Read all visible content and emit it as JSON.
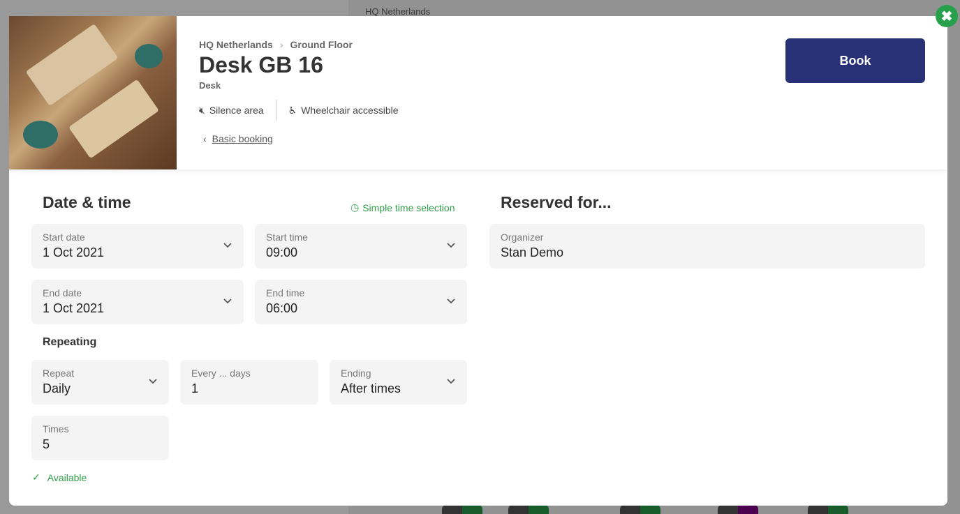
{
  "background": {
    "location": "HQ Netherlands"
  },
  "header": {
    "breadcrumb": [
      "HQ Netherlands",
      "Ground Floor"
    ],
    "title": "Desk GB 16",
    "type": "Desk",
    "features": [
      {
        "icon": "volume-off-icon",
        "label": "Silence area"
      },
      {
        "icon": "wheelchair-icon",
        "label": "Wheelchair accessible"
      }
    ],
    "basic_booking": "Basic booking",
    "book_label": "Book"
  },
  "datetime": {
    "heading": "Date & time",
    "simple_time": "Simple time selection",
    "start_date": {
      "label": "Start date",
      "value": "1 Oct 2021"
    },
    "start_time": {
      "label": "Start time",
      "value": "09:00"
    },
    "end_date": {
      "label": "End date",
      "value": "1 Oct 2021"
    },
    "end_time": {
      "label": "End time",
      "value": "06:00"
    },
    "repeating_heading": "Repeating",
    "repeat": {
      "label": "Repeat",
      "value": "Daily"
    },
    "every": {
      "label": "Every ... days",
      "value": "1"
    },
    "ending": {
      "label": "Ending",
      "value": "After times"
    },
    "times": {
      "label": "Times",
      "value": "5"
    },
    "availability": "Available"
  },
  "reserved": {
    "heading": "Reserved for...",
    "organizer": {
      "label": "Organizer",
      "value": "Stan Demo"
    }
  },
  "colors": {
    "accent": "#283176",
    "success": "#2fa04a"
  }
}
